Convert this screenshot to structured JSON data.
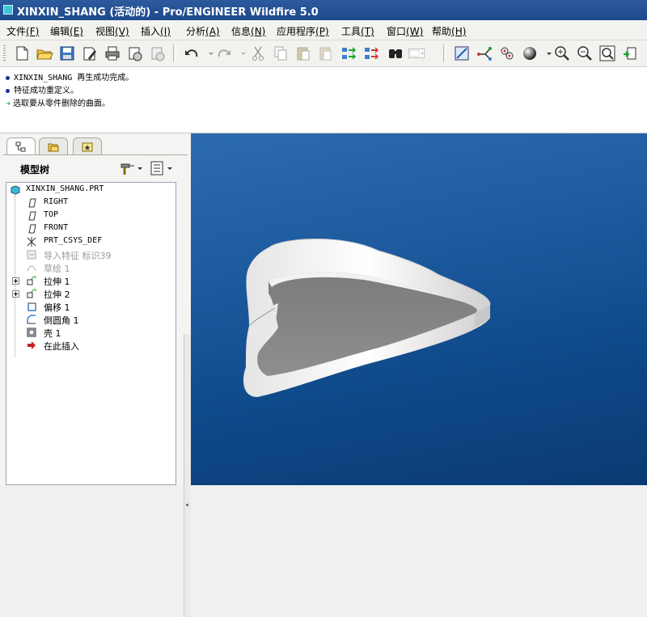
{
  "window": {
    "title": "XINXIN_SHANG (活动的) - Pro/ENGINEER Wildfire 5.0",
    "icon": "app-icon"
  },
  "menubar": {
    "items": [
      {
        "label": "文件",
        "accel": "(F)"
      },
      {
        "label": "编辑",
        "accel": "(E)"
      },
      {
        "label": "视图",
        "accel": "(V)"
      },
      {
        "label": "插入",
        "accel": "(I)"
      },
      {
        "label": "分析",
        "accel": "(A)"
      },
      {
        "label": "信息",
        "accel": "(N)"
      },
      {
        "label": "应用程序",
        "accel": "(P)"
      },
      {
        "label": "工具",
        "accel": "(T)"
      },
      {
        "label": "窗口",
        "accel": "(W)"
      },
      {
        "label": "帮助",
        "accel": "(H)"
      }
    ]
  },
  "toolbar": {
    "icons": [
      "new-file-icon",
      "open-folder-icon",
      "save-icon",
      "save-copy-icon",
      "print-icon",
      "email-icon",
      "email-link-icon",
      "undo-icon",
      "redo-icon",
      "cut-icon",
      "copy-icon",
      "paste-icon",
      "paste-special-icon",
      "regenerate-icon",
      "regen-manager-icon",
      "find-icon",
      "select-box-icon",
      "datum-display-icon",
      "datum-axis-icon",
      "datum-point-icon",
      "shading-icon",
      "zoom-in-icon",
      "zoom-out-icon",
      "refit-icon",
      "orient-icon"
    ]
  },
  "messages": [
    {
      "type": "info",
      "text": "XINXIN_SHANG 再生成功完成。"
    },
    {
      "type": "info",
      "text": "特征成功重定义。"
    },
    {
      "type": "prompt",
      "text": "选取要从零件删除的曲面。"
    }
  ],
  "left_panel": {
    "tabs": [
      "model-tree-tab",
      "folder-browser-tab",
      "favorites-tab"
    ],
    "header": "模型树",
    "tree": [
      {
        "label": "XINXIN_SHANG.PRT",
        "icon": "part-icon",
        "level": 0
      },
      {
        "label": "RIGHT",
        "icon": "datum-plane-icon",
        "level": 1
      },
      {
        "label": "TOP",
        "icon": "datum-plane-icon",
        "level": 1
      },
      {
        "label": "FRONT",
        "icon": "datum-plane-icon",
        "level": 1
      },
      {
        "label": "PRT_CSYS_DEF",
        "icon": "csys-icon",
        "level": 1
      },
      {
        "label": "导入特征 标识39",
        "icon": "import-feature-icon",
        "level": 1,
        "dim": true
      },
      {
        "label": "草绘 1",
        "icon": "sketch-icon",
        "level": 1,
        "dim": true
      },
      {
        "label": "拉伸 1",
        "icon": "extrude-icon",
        "level": 1,
        "expandable": true
      },
      {
        "label": "拉伸 2",
        "icon": "extrude-icon",
        "level": 1,
        "expandable": true
      },
      {
        "label": "偏移 1",
        "icon": "offset-icon",
        "level": 1
      },
      {
        "label": "倒圆角 1",
        "icon": "round-icon",
        "level": 1
      },
      {
        "label": "壳 1",
        "icon": "shell-icon",
        "level": 1
      },
      {
        "label": "在此插入",
        "icon": "insert-here-arrow-icon",
        "level": 1
      }
    ]
  },
  "viewport": {
    "model": "heart-shaped-shell",
    "background_top": "#2c6bb0",
    "background_bottom": "#0a3a73"
  }
}
